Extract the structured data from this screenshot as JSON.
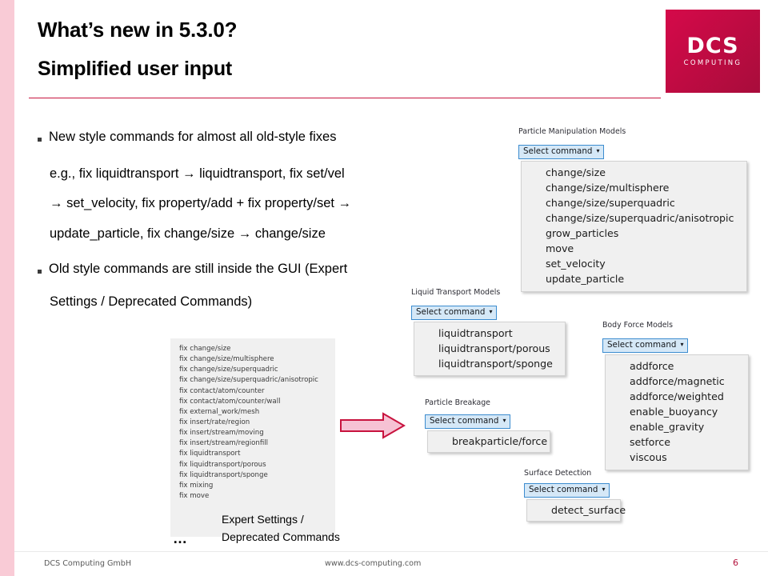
{
  "slide": {
    "title_line1": "What’s new in 5.3.0?",
    "title_line2": "Simplified user input",
    "accent_color": "#c8133e",
    "pink_bar_color": "#f9cbd6"
  },
  "logo": {
    "name": "DCS",
    "subtitle": "COMPUTING",
    "background_color": "#c10b43"
  },
  "bullets": [
    {
      "text": "New style commands  for almost all old-style fixes"
    },
    {
      "text": "Old style commands  are still inside the GUI (Expert"
    }
  ],
  "body_lines": {
    "eg_line1": "e.g., fix liquidtransport  → liquidtransport, fix set/vel",
    "eg_line2": "→ set_velocity, fix property/add + fix property/set →",
    "eg_line3": "update_particle, fix change/size → change/size",
    "old_line2": "Settings / Deprecated Commands)"
  },
  "annotation": {
    "line1": "Expert Settings /",
    "line2": "Deprecated Commands",
    "ellipsis": "…"
  },
  "select_button_label": "Select command",
  "caret_glyph": "▾",
  "gui_panels": [
    {
      "id": "particle-manipulation",
      "label": "Particle Manipulation Models",
      "items": [
        "change/size",
        "change/size/multisphere",
        "change/size/superquadric",
        "change/size/superquadric/anisotropic",
        "grow_particles",
        "move",
        "set_velocity",
        "update_particle"
      ]
    },
    {
      "id": "liquid-transport",
      "label": "Liquid Transport Models",
      "items": [
        "liquidtransport",
        "liquidtransport/porous",
        "liquidtransport/sponge"
      ]
    },
    {
      "id": "body-force",
      "label": "Body Force Models",
      "items": [
        "addforce",
        "addforce/magnetic",
        "addforce/weighted",
        "enable_buoyancy",
        "enable_gravity",
        "setforce",
        "viscous"
      ]
    },
    {
      "id": "particle-breakage",
      "label": "Particle Breakage",
      "items": [
        "breakparticle/force"
      ]
    },
    {
      "id": "surface-detection",
      "label": "Surface Detection",
      "items": [
        "detect_surface"
      ]
    }
  ],
  "deprecated_fix_list": [
    "fix change/size",
    "fix change/size/multisphere",
    "fix change/size/superquadric",
    "fix change/size/superquadric/anisotropic",
    "fix contact/atom/counter",
    "fix contact/atom/counter/wall",
    "fix external_work/mesh",
    "fix insert/rate/region",
    "fix insert/stream/moving",
    "fix insert/stream/regionfill",
    "fix liquidtransport",
    "fix liquidtransport/porous",
    "fix liquidtransport/sponge",
    "fix mixing",
    "fix move"
  ],
  "arrow": {
    "fill_color": "#f6c2d4",
    "stroke_color": "#c8133e"
  },
  "footer": {
    "company": "DCS Computing GmbH",
    "website": "www.dcs-computing.com",
    "page_number": "6"
  }
}
